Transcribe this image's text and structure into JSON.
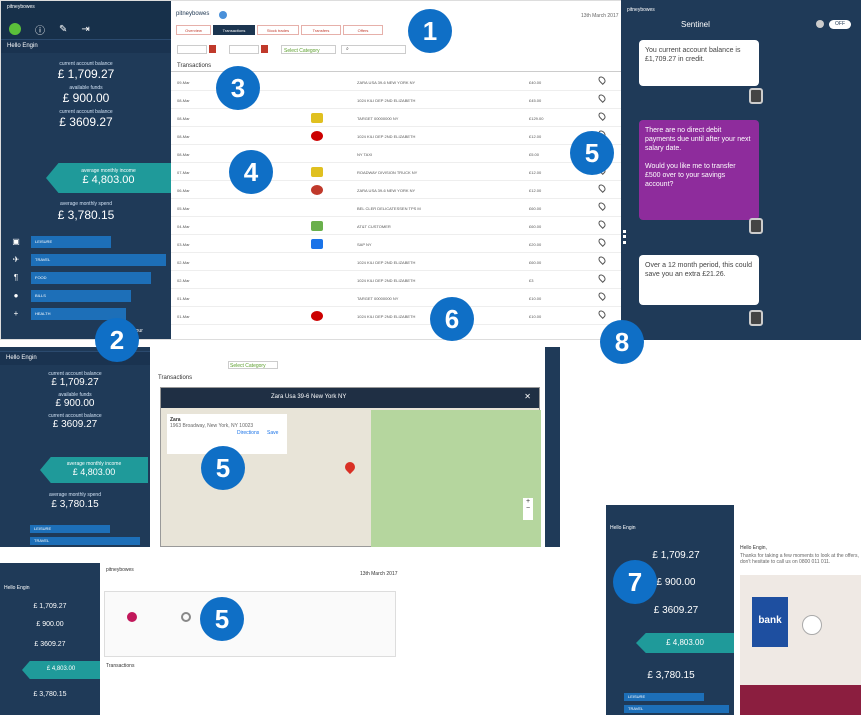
{
  "app": {
    "brand": "pitneybowes",
    "date": "13th March 2017",
    "greeting": "Hello Engin"
  },
  "tabs": [
    "Overview",
    "Transactions",
    "Stock trades",
    "Transfers",
    "Offers"
  ],
  "filters": {
    "category": "Select Category",
    "search_icon": "search-icon"
  },
  "transactions_title": "Transactions",
  "balances": [
    {
      "label": "current account balance",
      "value": "£ 1,709.27"
    },
    {
      "label": "available funds",
      "value": "£ 900.00"
    },
    {
      "label": "current account balance",
      "value": "£ 3609.27"
    }
  ],
  "income": {
    "label": "average monthly income",
    "value": "£ 4,803.00"
  },
  "spend": {
    "label": "average monthly spend",
    "value": "£ 3,780.15"
  },
  "categories": [
    "LEISURE",
    "TRAVEL",
    "FOOD",
    "BILLS",
    "HEALTH"
  ],
  "categories_footer": "View your",
  "transaction_rows": [
    {
      "date": "09-Mar",
      "desc": "ZARA USA 39-6 NEW YORK NY",
      "amount": "£40.00"
    },
    {
      "date": "08-Mar",
      "desc": "1024 KILI DEP 2ND ELIZABETH",
      "amount": "£45.00"
    },
    {
      "date": "08-Mar",
      "desc": "TARGET 00000000 NY",
      "amount": "£129.00"
    },
    {
      "date": "08-Mar",
      "desc": "1024 KILI DEP 2ND ELIZABETH",
      "amount": "£12.00"
    },
    {
      "date": "08-Mar",
      "desc": "NY TAXI",
      "amount": "£5.00"
    },
    {
      "date": "07-Mar",
      "desc": "ROADWAY DIVISION TRUCK NY",
      "amount": "£12.00"
    },
    {
      "date": "06-Mar",
      "desc": "ZARA USA 39-6 NEW YORK NY",
      "amount": "£12.00"
    },
    {
      "date": "05-Mar",
      "desc": "BEL CLER DELICATESSEN TPS M",
      "amount": "£60.00"
    },
    {
      "date": "04-Mar",
      "desc": "AT&T CUSTOMER",
      "amount": "£60.00"
    },
    {
      "date": "03-Mar",
      "desc": "SAP NY",
      "amount": "£20.00"
    },
    {
      "date": "02-Mar",
      "desc": "1024 KILI DEP 2ND ELIZABETH",
      "amount": "£60.00"
    },
    {
      "date": "02-Mar",
      "desc": "1024 KILI DEP 2ND ELIZABETH",
      "amount": "£3"
    },
    {
      "date": "01-Mar",
      "desc": "TARGET 00000000 NY",
      "amount": "£10.00"
    },
    {
      "date": "01-Mar",
      "desc": "1024 KILI DEP 2ND ELIZABETH",
      "amount": "£10.00"
    }
  ],
  "chat": {
    "title": "Sentinel",
    "toggle": "OFF",
    "m1": "You current account balance is £1,709.27 in credit.",
    "m2": "There are no direct debit payments due until after your next salary date.\n\nWould you like me to transfer £500 over to your savings account?",
    "m3": "Over a 12 month period, this could save you an extra £21.26."
  },
  "map": {
    "title": "Zara Usa 39-6 New York NY",
    "place": "Zara",
    "address": "1963 Broadway, New York, NY 10023",
    "directions": "Directions",
    "save": "Save"
  },
  "offer": {
    "greeting": "Hello Engin,",
    "text": "Thanks for taking a few moments to look at the offers, don't hesitate to call us on 0800 011 011.",
    "card": "bank"
  },
  "badges": [
    "1",
    "2",
    "3",
    "4",
    "5",
    "5",
    "5",
    "6",
    "7",
    "8"
  ],
  "colors": {
    "navy": "#1f3a58",
    "teal": "#1f9a9a",
    "blue": "#0f6fc6",
    "purple": "#8e2c9c",
    "red": "#c0392b"
  }
}
